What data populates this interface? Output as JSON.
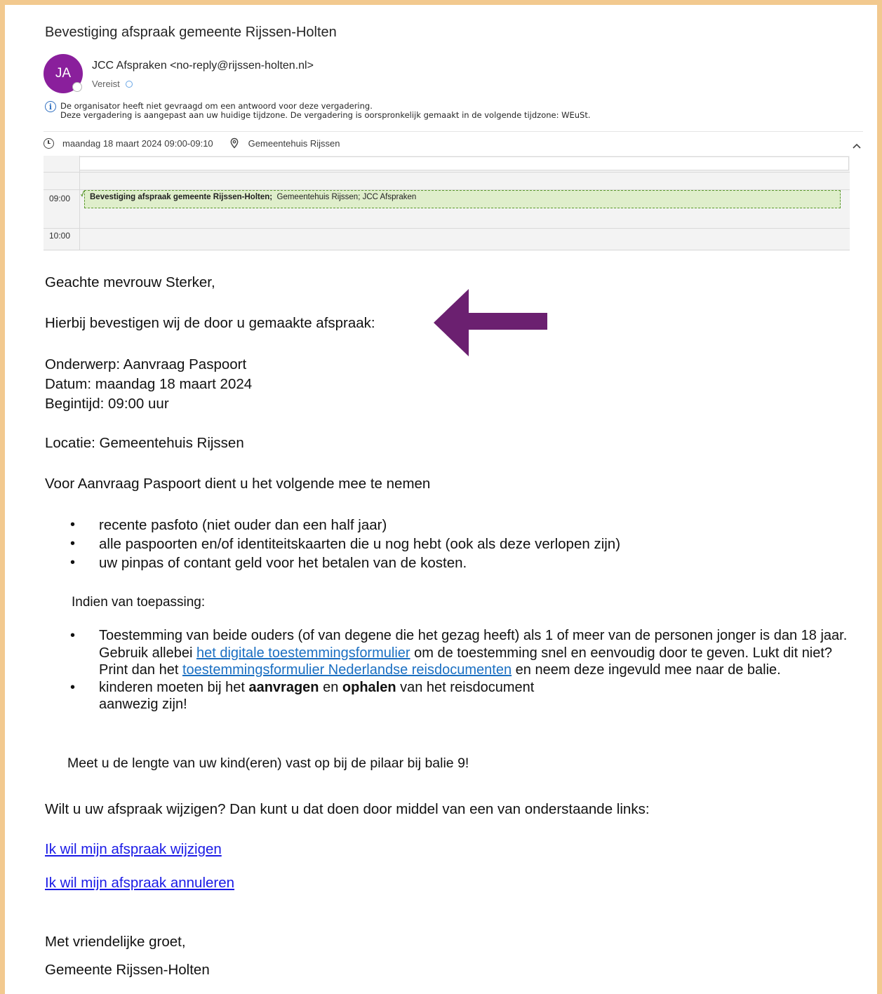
{
  "subject": "Bevestiging afspraak gemeente Rijssen-Holten",
  "sender": {
    "initials": "JA",
    "display": "JCC Afspraken <no-reply@rijssen-holten.nl>",
    "attendance": "Vereist"
  },
  "info": {
    "line1": "De organisator heeft niet gevraagd om een antwoord voor deze vergadering.",
    "line2": "Deze vergadering is aangepast aan uw huidige tijdzone. De vergadering is oorspronkelijk gemaakt in de volgende tijdzone: WEuSt."
  },
  "meeting": {
    "datetime": "maandag 18 maart 2024 09:00-09:10",
    "location": "Gemeentehuis Rijssen"
  },
  "calendar": {
    "time1": "09:00",
    "time2": "10:00",
    "event_bold": "Bevestiging afspraak gemeente Rijssen-Holten;",
    "event_rest": "Gemeentehuis Rijssen; JCC Afspraken",
    "event_color": "#dfeecb"
  },
  "body": {
    "greeting": "Geachte mevrouw Sterker,",
    "intro": "Hierbij bevestigen wij de door u gemaakte afspraak:",
    "onderwerp": "Onderwerp: Aanvraag Paspoort",
    "datum": "Datum: maandag 18 maart 2024",
    "begintijd": "Begintijd: 09:00 uur",
    "locatie": "Locatie: Gemeentehuis Rijssen",
    "meenemen": "Voor Aanvraag Paspoort dient u het volgende mee te nemen",
    "items": [
      "recente pasfoto (niet ouder dan een half jaar)",
      "alle paspoorten en/of identiteitskaarten die u nog hebt (ook als deze verlopen zijn)",
      "uw pinpas of contant geld voor het betalen van de kosten."
    ],
    "indien": "Indien van toepassing:",
    "toestemming": {
      "part1": "Toestemming van beide ouders (of van degene die het gezag heeft) als 1 of meer van de personen jonger is dan 18 jaar. Gebruik allebei ",
      "link1": "het digitale toestemmingsformulier",
      "part2": " om de toestemming snel en eenvoudig door te geven. Lukt dit niet? Print dan het ",
      "link2": "toestemmingsformulier Nederlandse reisdocumenten",
      "part3": " en neem deze ingevuld mee naar de balie."
    },
    "kinderen": {
      "part1": "kinderen moeten bij het ",
      "bold1": "aanvragen",
      "part2": " en ",
      "bold2": "ophalen",
      "part3": " van het reisdocument",
      "part4": "aanwezig zijn!"
    },
    "meet": "Meet u de lengte van uw kind(eren) vast op bij de pilaar bij balie 9!",
    "wijzigen_intro": "Wilt u uw afspraak wijzigen? Dan kunt u dat doen door middel van een van onderstaande links:",
    "link_wijzigen": "Ik wil mijn afspraak wijzigen",
    "link_annuleren": "Ik wil mijn afspraak annuleren",
    "groet": "Met vriendelijke groet,",
    "afzender": "Gemeente Rijssen-Holten"
  },
  "colors": {
    "frame": "#f2c98f",
    "avatar": "#8a1f9c",
    "arrow": "#6b2070",
    "link": "#1a6fc2"
  },
  "icons": [
    "info-icon",
    "clock-icon",
    "location-pin-icon",
    "chevron-up-icon",
    "arrow-left-icon"
  ]
}
